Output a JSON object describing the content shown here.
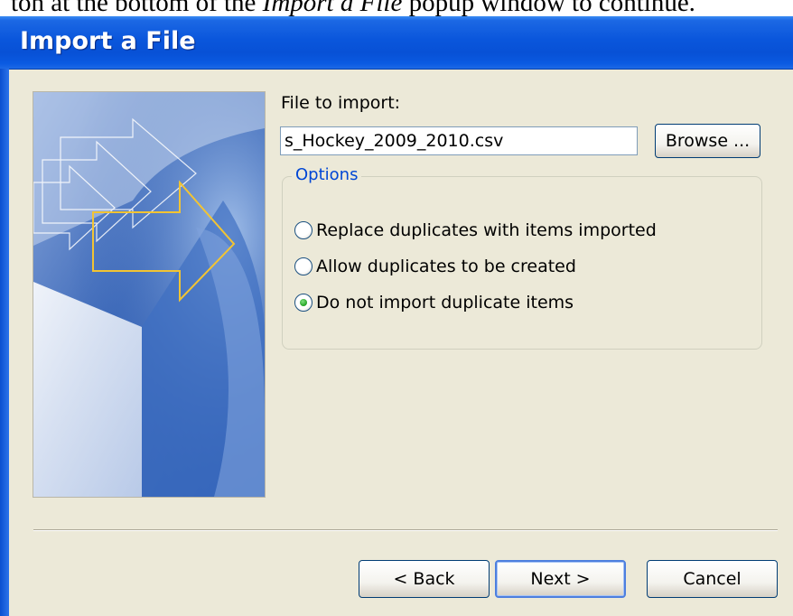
{
  "doc_text": {
    "prefix": "ton at the bottom of the ",
    "emphasis": "Import a File",
    "suffix": " popup window to continue."
  },
  "window": {
    "title": "Import a File"
  },
  "file": {
    "label": "File to import:",
    "value": "s_Hockey_2009_2010.csv",
    "browse_label": "Browse ..."
  },
  "options": {
    "legend": "Options",
    "items": [
      {
        "label": "Replace duplicates with items imported",
        "checked": false
      },
      {
        "label": "Allow duplicates to be created",
        "checked": false
      },
      {
        "label": "Do not import duplicate items",
        "checked": true
      }
    ]
  },
  "footer": {
    "back_label": "< Back",
    "next_label": "Next >",
    "cancel_label": "Cancel"
  },
  "colors": {
    "titlebar": "#0a56dc",
    "dialog_bg": "#ece9d8",
    "legend_text": "#0046d5",
    "radio_checked": "#21a121",
    "arrow_accent": "#f2c433"
  }
}
